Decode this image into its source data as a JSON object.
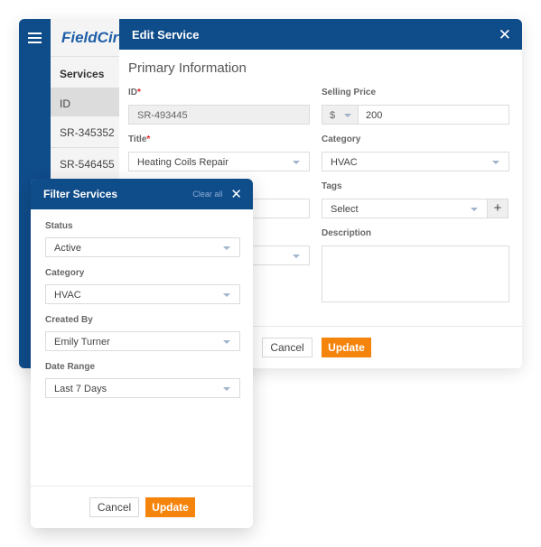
{
  "app": {
    "logo_text": "FieldCircle",
    "list_title": "Services",
    "column_header": "ID",
    "rows": [
      "SR-345352",
      "SR-546455"
    ]
  },
  "edit_modal": {
    "title": "Edit Service",
    "section_title": "Primary Information",
    "fields": {
      "id": {
        "label": "ID",
        "required": "*",
        "value": "SR-493445"
      },
      "title": {
        "label": "Title",
        "required": "*",
        "value": "Heating Coils Repair"
      },
      "selling_price": {
        "label": "Selling Price",
        "currency": "$",
        "value": "200"
      },
      "category": {
        "label": "Category",
        "value": "HVAC"
      },
      "tags": {
        "label": "Tags",
        "placeholder": "Select",
        "add_symbol": "+"
      },
      "description": {
        "label": "Description",
        "value": ""
      }
    },
    "cancel_label": "Cancel",
    "update_label": "Update"
  },
  "filter_panel": {
    "title": "Filter Services",
    "clear_all_label": "Clear all",
    "fields": [
      {
        "label": "Status",
        "value": "Active"
      },
      {
        "label": "Category",
        "value": "HVAC"
      },
      {
        "label": "Created By",
        "value": "Emily Turner"
      },
      {
        "label": "Date Range",
        "value": "Last 7 Days"
      }
    ],
    "cancel_label": "Cancel",
    "update_label": "Update"
  },
  "colors": {
    "brand_blue": "#0f4c8a",
    "accent_orange": "#f5840c",
    "required_red": "#e02020"
  }
}
